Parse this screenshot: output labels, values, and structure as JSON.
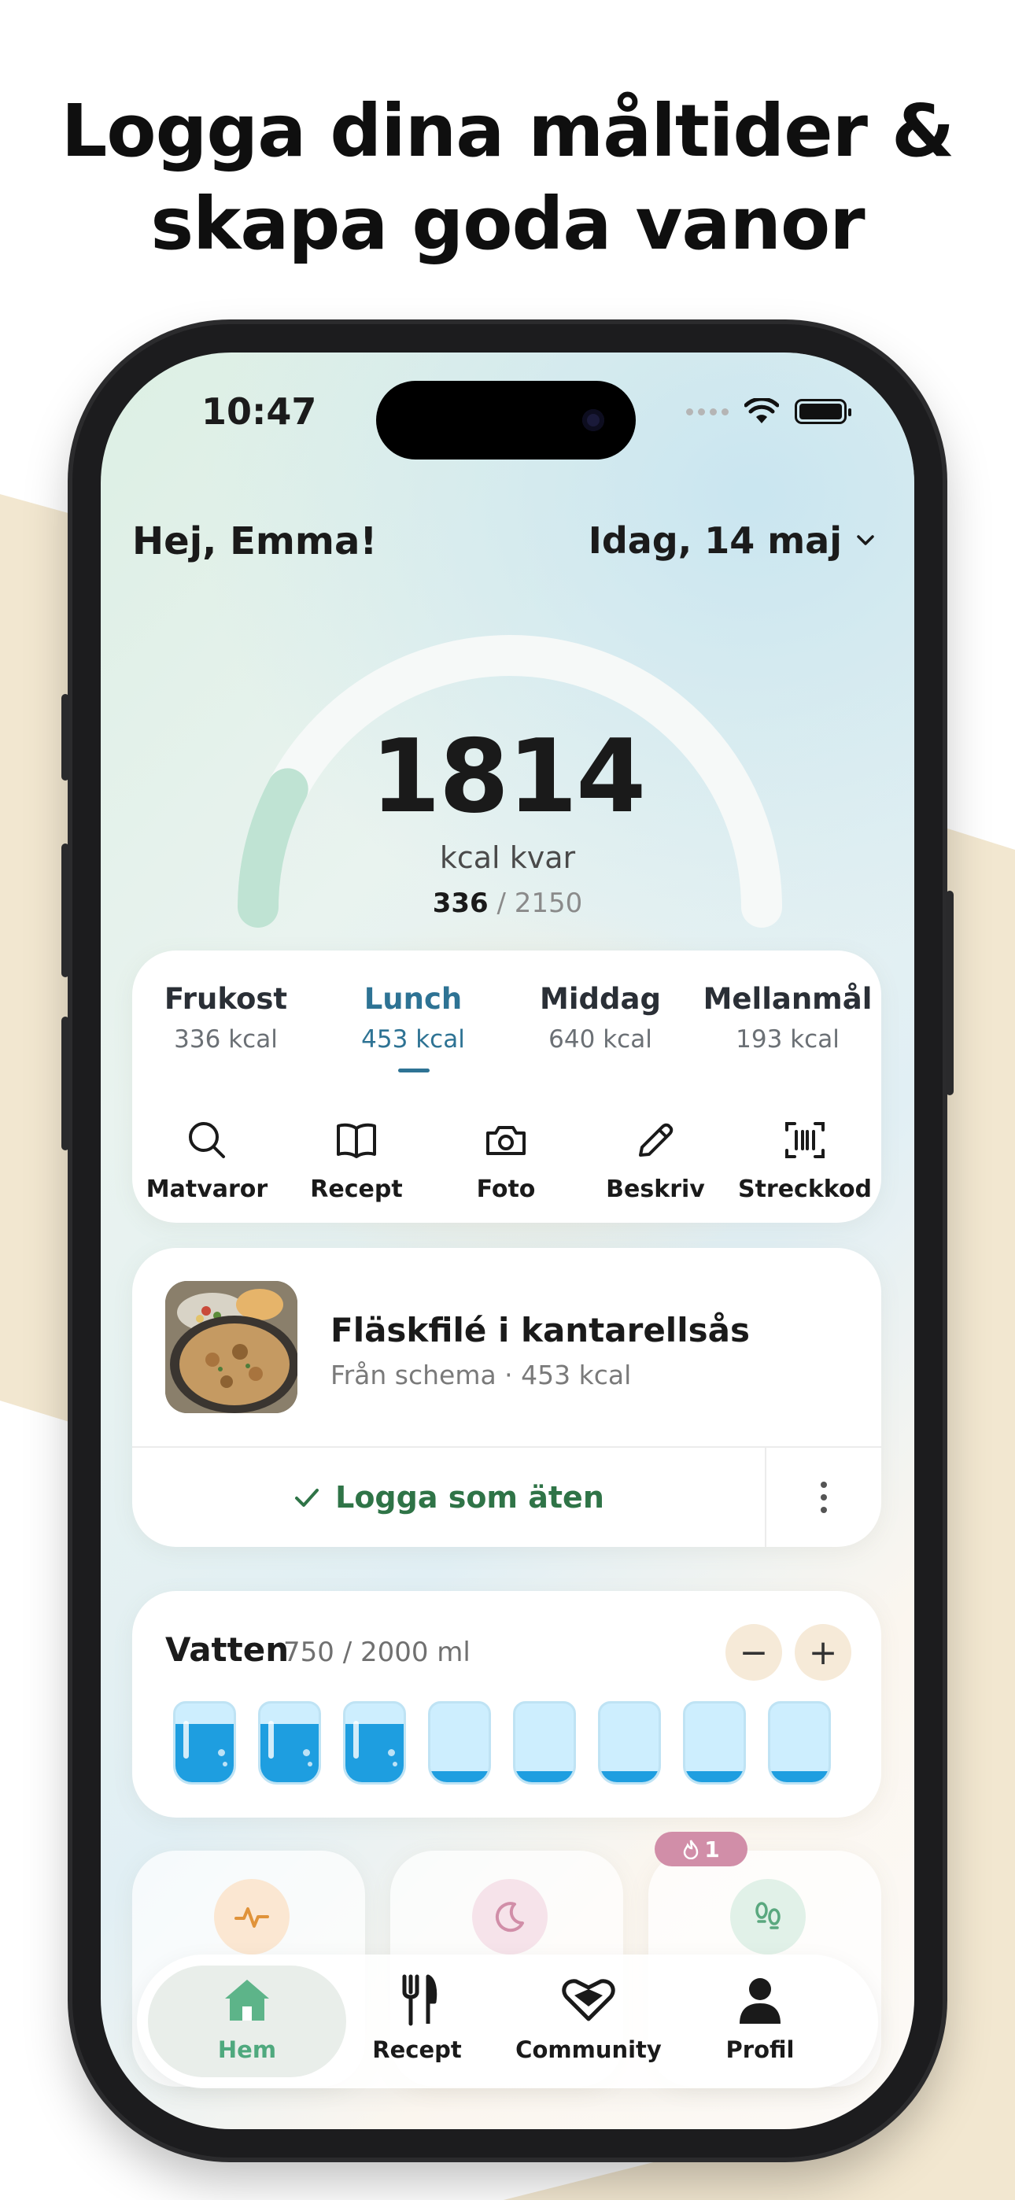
{
  "headline": {
    "line1": "Logga dina måltider &",
    "line2": "skapa goda vanor"
  },
  "status_bar": {
    "time": "10:47"
  },
  "header": {
    "greeting": "Hej, Emma!",
    "date": "Idag, 14 maj"
  },
  "calories": {
    "remaining": "1814",
    "unit": "kcal kvar",
    "eaten": "336",
    "goal": "/ 2150",
    "progress_fraction": 0.156
  },
  "meals": [
    {
      "name": "Frukost",
      "kcal": "336 kcal"
    },
    {
      "name": "Lunch",
      "kcal": "453 kcal",
      "active": true
    },
    {
      "name": "Middag",
      "kcal": "640 kcal"
    },
    {
      "name": "Mellanmål",
      "kcal": "193 kcal"
    }
  ],
  "actions": [
    {
      "label": "Matvaror",
      "icon": "search-icon"
    },
    {
      "label": "Recept",
      "icon": "book-icon"
    },
    {
      "label": "Foto",
      "icon": "camera-icon"
    },
    {
      "label": "Beskriv",
      "icon": "pencil-icon"
    },
    {
      "label": "Streckkod",
      "icon": "barcode-icon"
    }
  ],
  "food": {
    "title": "Fläskfilé i kantarellsås",
    "subtitle": "Från schema · 453 kcal",
    "log_label": "Logga som äten"
  },
  "water": {
    "title": "Vatten",
    "amount": "750 / 2000 ml",
    "minus": "−",
    "plus": "+",
    "cups_filled": 3,
    "cups_total": 8
  },
  "streak": {
    "count": "1"
  },
  "tabbar": [
    {
      "label": "Hem",
      "icon": "home-icon",
      "active": true
    },
    {
      "label": "Recept",
      "icon": "fork-knife-icon"
    },
    {
      "label": "Community",
      "icon": "heart-hands-icon"
    },
    {
      "label": "Profil",
      "icon": "person-icon"
    }
  ],
  "colors": {
    "accent_blue": "#2e7394",
    "accent_green": "#2f7447",
    "gauge_progress": "#bfe3d3",
    "water_blue": "#1e9ee0",
    "background_beige": "#f2e7d0"
  }
}
